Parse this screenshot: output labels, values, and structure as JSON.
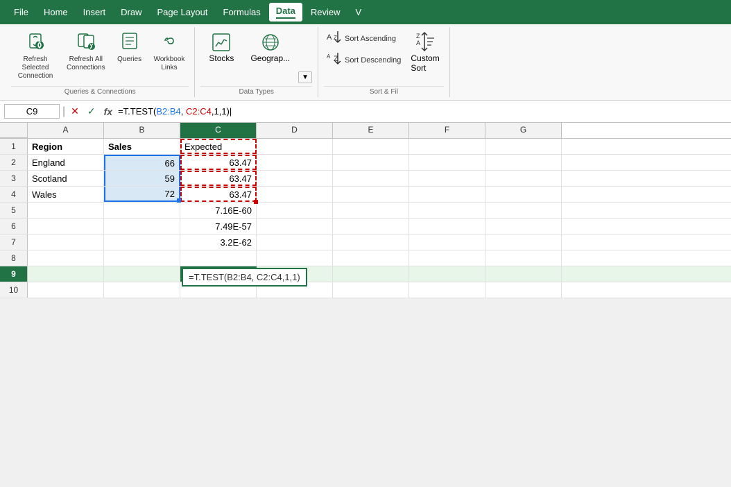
{
  "menu": {
    "items": [
      "File",
      "Home",
      "Insert",
      "Draw",
      "Page Layout",
      "Formulas",
      "Data",
      "Review",
      "V"
    ],
    "active": "Data"
  },
  "ribbon": {
    "groups": {
      "queries_connections": {
        "label": "Queries & Connections",
        "buttons": [
          {
            "id": "refresh-selected",
            "icon": "🔄",
            "label": "Refresh Selected\nConnection"
          },
          {
            "id": "refresh-all",
            "icon": "🔄",
            "label": "Refresh All\nConnections"
          },
          {
            "id": "queries",
            "icon": "📋",
            "label": "Queries"
          },
          {
            "id": "workbook-links",
            "icon": "🔗",
            "label": "Workbook\nLinks"
          }
        ]
      },
      "data_types": {
        "label": "Data Types",
        "buttons": [
          {
            "id": "stocks",
            "icon": "🏛",
            "label": "Stocks"
          },
          {
            "id": "geography",
            "icon": "🗺",
            "label": "Geograp..."
          }
        ]
      },
      "sort_filter": {
        "label": "Sort & Fil",
        "sort_ascending": "Sort Ascending",
        "sort_descending": "Sort Descending",
        "custom_label": "Custom\nSort"
      }
    }
  },
  "formula_bar": {
    "cell_ref": "C9",
    "formula_prefix": "=T.TEST(",
    "formula_b2b4": "B2:B4",
    "formula_separator": ", ",
    "formula_c2c4": "C2:C4",
    "formula_suffix": ",1,1)",
    "formula_full": "=T.TEST(B2:B4, C2:C4,1,1)"
  },
  "spreadsheet": {
    "col_headers": [
      "A",
      "B",
      "C",
      "D",
      "E",
      "F",
      "G"
    ],
    "rows": [
      {
        "num": 1,
        "a": "Region",
        "b": "Sales",
        "c": "Expected",
        "d": "",
        "e": "",
        "f": "",
        "g": ""
      },
      {
        "num": 2,
        "a": "England",
        "b": "66",
        "c": "63.47",
        "d": "",
        "e": "",
        "f": "",
        "g": ""
      },
      {
        "num": 3,
        "a": "Scotland",
        "b": "59",
        "c": "63.47",
        "d": "",
        "e": "",
        "f": "",
        "g": ""
      },
      {
        "num": 4,
        "a": "Wales",
        "b": "72",
        "c": "63.47",
        "d": "",
        "e": "",
        "f": "",
        "g": ""
      },
      {
        "num": 5,
        "a": "",
        "b": "",
        "c": "7.16E-60",
        "d": "",
        "e": "",
        "f": "",
        "g": ""
      },
      {
        "num": 6,
        "a": "",
        "b": "",
        "c": "7.49E-57",
        "d": "",
        "e": "",
        "f": "",
        "g": ""
      },
      {
        "num": 7,
        "a": "",
        "b": "",
        "c": "3.2E-62",
        "d": "",
        "e": "",
        "f": "",
        "g": ""
      },
      {
        "num": 8,
        "a": "",
        "b": "",
        "c": "",
        "d": "",
        "e": "",
        "f": "",
        "g": ""
      },
      {
        "num": 9,
        "a": "",
        "b": "",
        "c": "",
        "d": "",
        "e": "",
        "f": "",
        "g": ""
      },
      {
        "num": 10,
        "a": "",
        "b": "",
        "c": "",
        "d": "",
        "e": "",
        "f": "",
        "g": ""
      }
    ],
    "formula_box_text": "=T.TEST(B2:B4, C2:C4,1,1)"
  }
}
